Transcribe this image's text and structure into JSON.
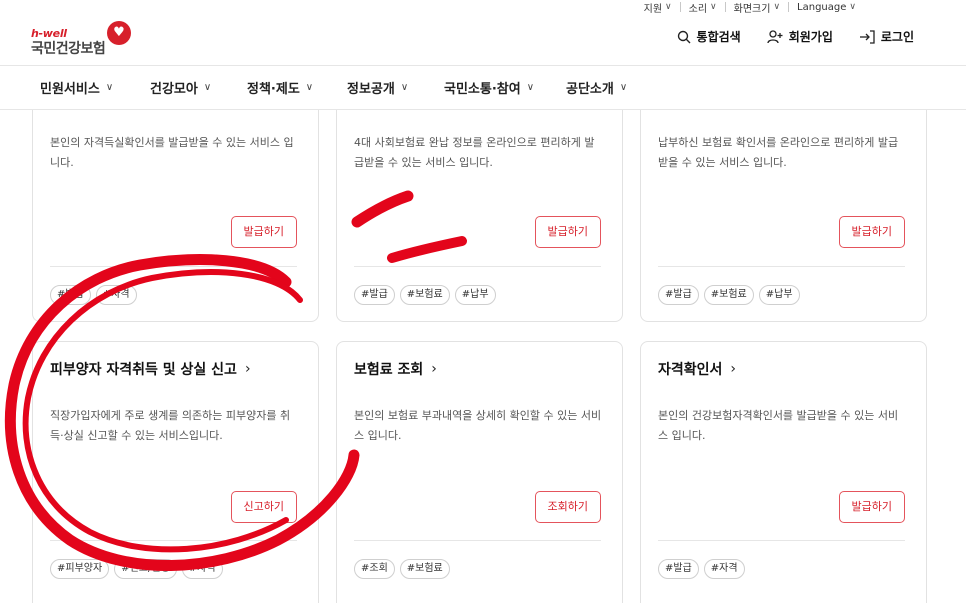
{
  "utility": {
    "items": [
      {
        "label": "지원"
      },
      {
        "label": "소리"
      },
      {
        "label": "화면크기"
      },
      {
        "label": "Language"
      }
    ]
  },
  "logo": {
    "brand": "h-well",
    "name": "국민건강보험"
  },
  "header": {
    "search": "통합검색",
    "signup": "회원가입",
    "login": "로그인"
  },
  "gnb": [
    {
      "label": "민원서비스"
    },
    {
      "label": "건강모아"
    },
    {
      "label": "정책·제도"
    },
    {
      "label": "정보공개"
    },
    {
      "label": "국민소통·참여"
    },
    {
      "label": "공단소개"
    }
  ],
  "cards_top": [
    {
      "desc": "본인의 자격득실확인서를 발급받을 수 있는 서비스 입니다.",
      "button": "발급하기",
      "tags": [
        "#발급",
        "#자격"
      ]
    },
    {
      "desc": "4대 사회보험료 완납 정보를 온라인으로 편리하게 발급받을 수 있는 서비스 입니다.",
      "button": "발급하기",
      "tags": [
        "#발급",
        "#보험료",
        "#납부"
      ]
    },
    {
      "desc": "납부하신 보험료 확인서를 온라인으로 편리하게 발급받을 수 있는 서비스 입니다.",
      "button": "발급하기",
      "tags": [
        "#발급",
        "#보험료",
        "#납부"
      ]
    }
  ],
  "cards_bottom": [
    {
      "title": "피부양자 자격취득 및 상실 신고",
      "desc": "직장가입자에게 주로 생계를 의존하는 피부양자를 취득·상실 신고할 수 있는 서비스입니다.",
      "button": "신고하기",
      "tags": [
        "#피부양자",
        "#신고/신청",
        "#자격"
      ]
    },
    {
      "title": "보험료 조회",
      "desc": "본인의 보험료 부과내역을 상세히 확인할 수 있는 서비스 입니다.",
      "button": "조회하기",
      "tags": [
        "#조회",
        "#보험료"
      ]
    },
    {
      "title": "자격확인서",
      "desc": "본인의 건강보험자격확인서를 발급받을 수 있는 서비스 입니다.",
      "button": "발급하기",
      "tags": [
        "#발급",
        "#자격"
      ]
    }
  ],
  "colors": {
    "brand_red": "#d7202b",
    "annotation_red": "#e3051b"
  }
}
